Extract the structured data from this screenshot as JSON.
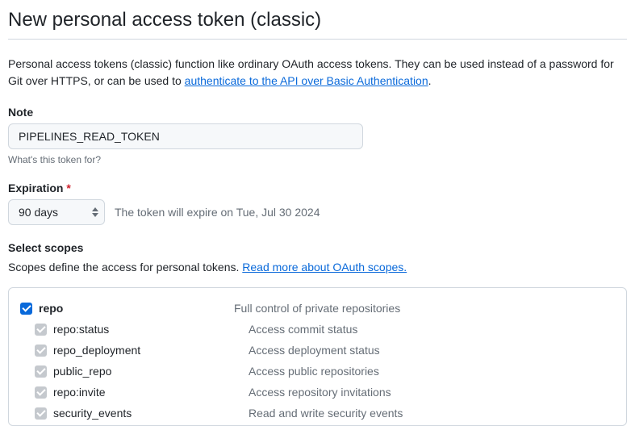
{
  "title": "New personal access token (classic)",
  "intro": {
    "prefix": "Personal access tokens (classic) function like ordinary OAuth access tokens. They can be used instead of a password for Git over HTTPS, or can be used to ",
    "link": "authenticate to the API over Basic Authentication",
    "suffix": "."
  },
  "note": {
    "label": "Note",
    "value": "PIPELINES_READ_TOKEN",
    "help": "What's this token for?"
  },
  "expiration": {
    "label": "Expiration",
    "value": "90 days",
    "message": "The token will expire on Tue, Jul 30 2024"
  },
  "scopes": {
    "heading": "Select scopes",
    "intro_prefix": "Scopes define the access for personal tokens. ",
    "intro_link": "Read more about OAuth scopes.",
    "items": [
      {
        "name": "repo",
        "desc": "Full control of private repositories",
        "level": 0,
        "state": "primary"
      },
      {
        "name": "repo:status",
        "desc": "Access commit status",
        "level": 1,
        "state": "disabled"
      },
      {
        "name": "repo_deployment",
        "desc": "Access deployment status",
        "level": 1,
        "state": "disabled"
      },
      {
        "name": "public_repo",
        "desc": "Access public repositories",
        "level": 1,
        "state": "disabled"
      },
      {
        "name": "repo:invite",
        "desc": "Access repository invitations",
        "level": 1,
        "state": "disabled"
      },
      {
        "name": "security_events",
        "desc": "Read and write security events",
        "level": 1,
        "state": "disabled"
      }
    ]
  }
}
